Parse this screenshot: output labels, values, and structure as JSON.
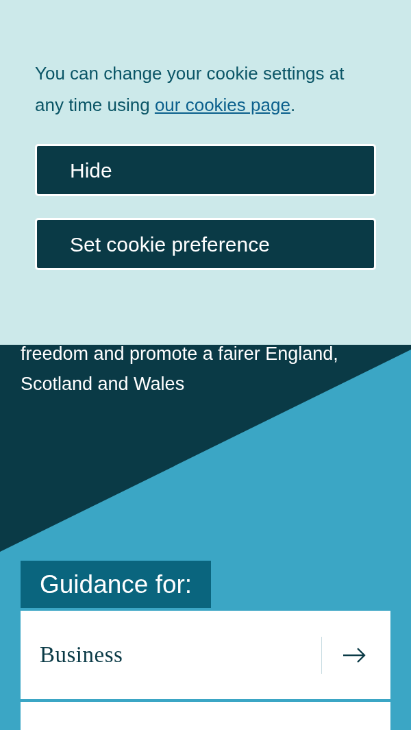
{
  "cookie_banner": {
    "message": "You can change your cookie settings at any time using ",
    "link": "our cookies page",
    "message_end": ".",
    "buttons": [
      "Hide",
      "Set cookie preference"
    ]
  },
  "hero": {
    "lines": [
      "freedom and promote a fairer England,",
      "Scotland and Wales"
    ]
  },
  "guidance": {
    "heading": "Guidance for:",
    "items": [
      "Business"
    ]
  }
}
